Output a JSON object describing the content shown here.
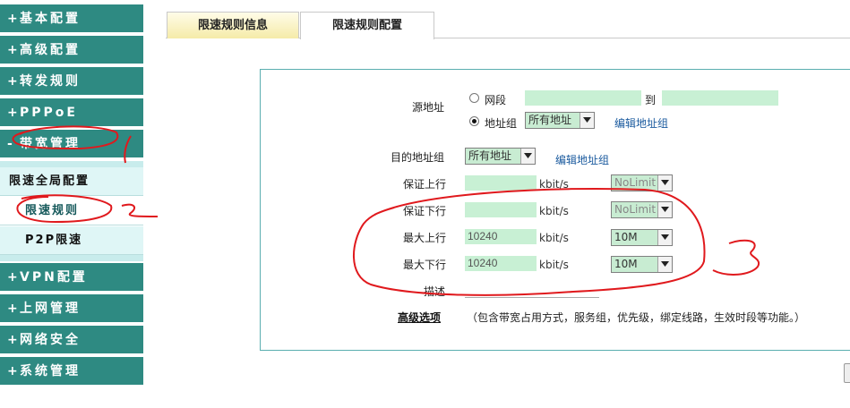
{
  "sidebar": {
    "items_top": [
      {
        "prefix": "+",
        "label": "基本配置"
      },
      {
        "prefix": "+",
        "label": "高级配置"
      },
      {
        "prefix": "+",
        "label": "转发规则"
      },
      {
        "prefix": "+",
        "label": "PPPoE"
      },
      {
        "prefix": "-",
        "label": "带宽管理"
      }
    ],
    "sub_items": [
      {
        "label": "限速全局配置"
      },
      {
        "label": "限速规则"
      },
      {
        "label": "P2P限速"
      }
    ],
    "items_bottom": [
      {
        "prefix": "+",
        "label": "VPN配置"
      },
      {
        "prefix": "+",
        "label": "上网管理"
      },
      {
        "prefix": "+",
        "label": "网络安全"
      },
      {
        "prefix": "+",
        "label": "系统管理"
      }
    ]
  },
  "tabs": [
    {
      "label": "限速规则信息"
    },
    {
      "label": "限速规则配置"
    }
  ],
  "form": {
    "source": {
      "label": "源地址",
      "option_segment": "网段",
      "segment_to": "到",
      "option_group": "地址组",
      "group_select": "所有地址",
      "edit_link": "编辑地址组"
    },
    "dest": {
      "label": "目的地址组",
      "select": "所有地址",
      "edit_link": "编辑地址组"
    },
    "rows": [
      {
        "label": "保证上行",
        "value": "",
        "unit": "kbit/s",
        "select": "NoLimit"
      },
      {
        "label": "保证下行",
        "value": "",
        "unit": "kbit/s",
        "select": "NoLimit"
      },
      {
        "label": "最大上行",
        "value": "10240",
        "unit": "kbit/s",
        "select": "10M"
      },
      {
        "label": "最大下行",
        "value": "10240",
        "unit": "kbit/s",
        "select": "10M"
      }
    ],
    "desc_label": "描述",
    "advanced_label": "高级选项",
    "advanced_note": "（包含带宽占用方式，服务组，优先级，绑定线路，生效时段等功能。）"
  },
  "colors": {
    "sidebar_bg": "#2e8a82",
    "submenu_bg": "#dff6f6",
    "field_green": "#c8f0d4",
    "panel_border": "#5aaeb0",
    "link": "#1a5a9e",
    "annotation_red": "#e0191d"
  }
}
